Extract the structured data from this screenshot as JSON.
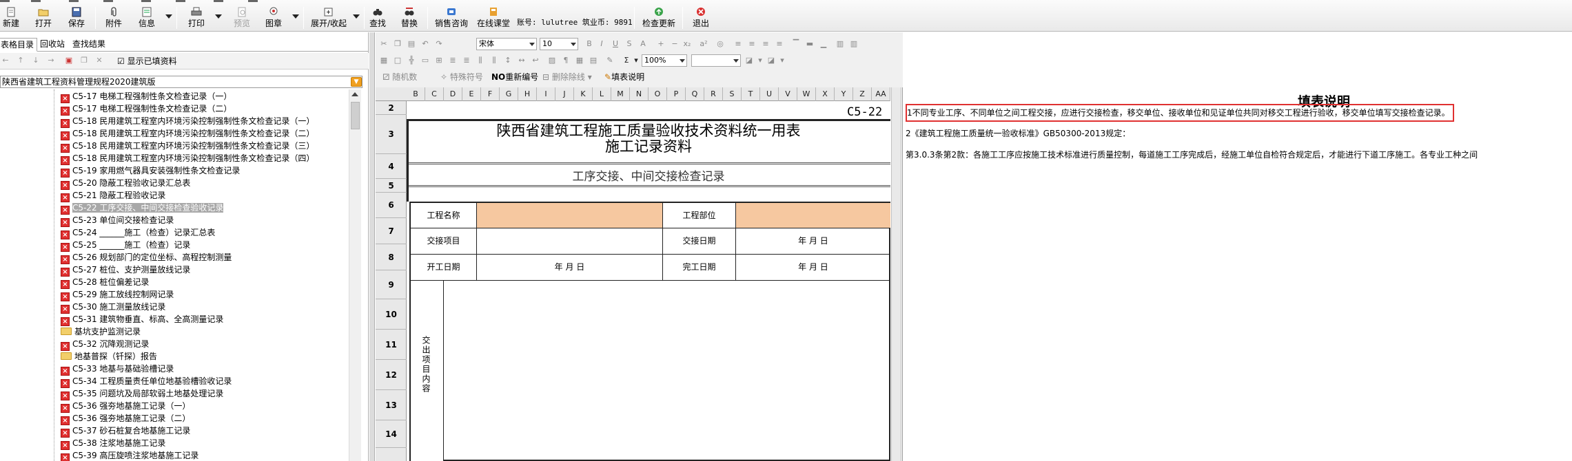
{
  "toolbar": {
    "buttons": [
      {
        "label": "新建"
      },
      {
        "label": "打开"
      },
      {
        "label": "保存"
      },
      {
        "label": "附件"
      },
      {
        "label": "信息"
      },
      {
        "label": "打印"
      },
      {
        "label": "预览"
      },
      {
        "label": "图章"
      },
      {
        "label": "展开/收起"
      },
      {
        "label": "查找"
      },
      {
        "label": "替换"
      },
      {
        "label": "销售咨询"
      },
      {
        "label": "在线课堂"
      },
      {
        "label": "检查更新"
      },
      {
        "label": "退出"
      }
    ],
    "account_text": "账号: lulutree 筑业币: 9891"
  },
  "left_panel": {
    "tabs": [
      {
        "label": "表格目录"
      },
      {
        "label": "回收站"
      },
      {
        "label": "查找结果"
      }
    ],
    "show_filled_label": "显示已填资料",
    "spec_selector": "陕西省建筑工程资料管理规程2020建筑版",
    "tree_items": [
      {
        "label": "C5-17 电梯工程强制性条文检查记录（一）",
        "type": "doc"
      },
      {
        "label": "C5-17 电梯工程强制性条文检查记录（二）",
        "type": "doc"
      },
      {
        "label": "C5-18 民用建筑工程室内环境污染控制强制性条文检查记录（一）",
        "type": "doc"
      },
      {
        "label": "C5-18 民用建筑工程室内环境污染控制强制性条文检查记录（二）",
        "type": "doc"
      },
      {
        "label": "C5-18 民用建筑工程室内环境污染控制强制性条文检查记录（三）",
        "type": "doc"
      },
      {
        "label": "C5-18 民用建筑工程室内环境污染控制强制性条文检查记录（四）",
        "type": "doc"
      },
      {
        "label": "C5-19 家用燃气器具安装强制性条文检查记录",
        "type": "doc"
      },
      {
        "label": "C5-20 隐蔽工程验收记录汇总表",
        "type": "doc"
      },
      {
        "label": "C5-21 隐蔽工程验收记录",
        "type": "doc"
      },
      {
        "label": "C5-22 工序交接、中间交接检查验收记录",
        "type": "doc",
        "selected": true
      },
      {
        "label": "C5-23 单位间交接检查记录",
        "type": "doc"
      },
      {
        "label": "C5-24 ______施工（检查）记录汇总表",
        "type": "doc"
      },
      {
        "label": "C5-25 ______施工（检查）记录",
        "type": "doc"
      },
      {
        "label": "C5-26 规划部门的定位坐标、高程控制测量",
        "type": "doc"
      },
      {
        "label": "C5-27 桩位、支护测量放线记录",
        "type": "doc"
      },
      {
        "label": "C5-28 桩位偏差记录",
        "type": "doc"
      },
      {
        "label": "C5-29 施工放线控制网记录",
        "type": "doc"
      },
      {
        "label": "C5-30 施工测量放线记录",
        "type": "doc"
      },
      {
        "label": "C5-31 建筑物垂直、标高、全高测量记录",
        "type": "doc"
      },
      {
        "label": "基坑支护监测记录",
        "type": "folder"
      },
      {
        "label": "C5-32 沉降观测记录",
        "type": "doc"
      },
      {
        "label": "地基普探（钎探）报告",
        "type": "folder"
      },
      {
        "label": "C5-33 地基与基础验槽记录",
        "type": "doc"
      },
      {
        "label": "C5-34 工程质量责任单位地基验槽验收记录",
        "type": "doc"
      },
      {
        "label": "C5-35 问题坑及局部软弱土地基处理记录",
        "type": "doc"
      },
      {
        "label": "C5-36 强夯地基施工记录（一）",
        "type": "doc"
      },
      {
        "label": "C5-36 强夯地基施工记录（二）",
        "type": "doc"
      },
      {
        "label": "C5-37 砂石桩复合地基施工记录",
        "type": "doc"
      },
      {
        "label": "C5-38 注浆地基施工记录",
        "type": "doc"
      },
      {
        "label": "C5-39 高压旋喷注浆地基施工记录",
        "type": "doc"
      }
    ]
  },
  "editor_toolbar": {
    "font_name": "宋体",
    "font_size": "10",
    "zoom": "100%",
    "sigma": "Σ",
    "random_number_label": "随机数",
    "special_char_label": "特殊符号",
    "renumber_label": "重新编号",
    "delete_blank_rows_label": "删除除线",
    "fill_instructions_label": "填表说明"
  },
  "sheet": {
    "columns": [
      "B",
      "C",
      "D",
      "E",
      "F",
      "G",
      "H",
      "I",
      "J",
      "K",
      "L",
      "M",
      "N",
      "O",
      "P",
      "Q",
      "R",
      "S",
      "T",
      "U",
      "V",
      "W",
      "X",
      "Y",
      "Z",
      "AA"
    ],
    "rows": [
      "2",
      "3",
      "4",
      "5",
      "6",
      "7",
      "8",
      "9",
      "10",
      "11",
      "12",
      "13",
      "14"
    ],
    "form_code": "C5-22",
    "form_title_line1": "陕西省建筑工程施工质量验收技术资料统一用表",
    "form_title_line2": "施工记录资料",
    "form_subtitle": "工序交接、中间交接检查记录",
    "fields": {
      "project_name_label": "工程名称",
      "project_part_label": "工程部位",
      "handover_item_label": "交接项目",
      "handover_date_label": "交接日期",
      "start_date_label": "开工日期",
      "finish_date_label": "完工日期",
      "date_placeholder": "年   月   日",
      "handover_content_label": "交出项目内容"
    }
  },
  "notes": {
    "title": "填表说明",
    "line1": "1不同专业工序、不同单位之间工程交接，应进行交接检查，移交单位、接收单位和见证单位共同对移交工程进行验收，移交单位填写交接检查记录。",
    "line2": "2《建筑工程施工质量统一验收标准》GB50300-2013规定：",
    "line3": "第3.0.3条第2款：各施工工序应按施工技术标准进行质量控制，每道施工工序完成后，经施工单位自检符合规定后，才能进行下道工序施工。各专业工种之间"
  },
  "colors": {
    "selection": "#a8a8a8",
    "highlight_cell": "#f6c8a0",
    "notes_box": "#e03030",
    "doc_icon": "#e03030",
    "folder_icon": "#f2cf6a"
  }
}
